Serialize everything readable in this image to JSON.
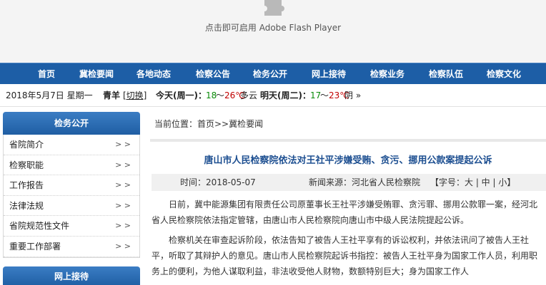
{
  "flash": {
    "message": "点击即可启用 Adobe Flash Player"
  },
  "nav": [
    "首页",
    "冀检要闻",
    "各地动态",
    "检察公告",
    "检务公开",
    "网上接待",
    "检察业务",
    "检察队伍",
    "检察文化"
  ],
  "strip": {
    "date": "2018年5月7日 星期一",
    "city": "青羊",
    "switch": "[切换]",
    "today_label": "今天(周一)：",
    "today_low": "18",
    "today_sep": "～",
    "today_high": "26℃",
    "today_cond": "多云",
    "tomorrow_label": "明天(周二)：",
    "tomorrow_low": "17",
    "tomorrow_sep": "～",
    "tomorrow_high": "23℃",
    "tomorrow_cond": "阴 »"
  },
  "sidebar": {
    "title": "检务公开",
    "items": [
      "省院简介",
      "检察职能",
      "工作报告",
      "法律法规",
      "省院规范性文件",
      "重要工作部署"
    ],
    "arrow": "> >",
    "title2": "网上接待"
  },
  "main": {
    "breadcrumb": "当前位置：首页>>冀检要闻",
    "title": "唐山市人民检察院依法对王社平涉嫌受贿、贪污、挪用公款案提起公诉",
    "time": "时间：2018-05-07",
    "source": "新闻来源：河北省人民检察院",
    "fontsize": "【字号：大 | 中 | 小】",
    "paragraphs": [
      "日前，冀中能源集团有限责任公司原董事长王社平涉嫌受贿罪、贪污罪、挪用公款罪一案，经河北省人民检察院依法指定管辖，由唐山市人民检察院向唐山市中级人民法院提起公诉。",
      "检察机关在审查起诉阶段，依法告知了被告人王社平享有的诉讼权利，并依法讯问了被告人王社平，听取了其辩护人的意见。唐山市人民检察院起诉书指控：被告人王社平身为国家工作人员，利用职务上的便利，为他人谋取利益，非法收受他人财物，数额特别巨大；身为国家工作人"
    ]
  }
}
